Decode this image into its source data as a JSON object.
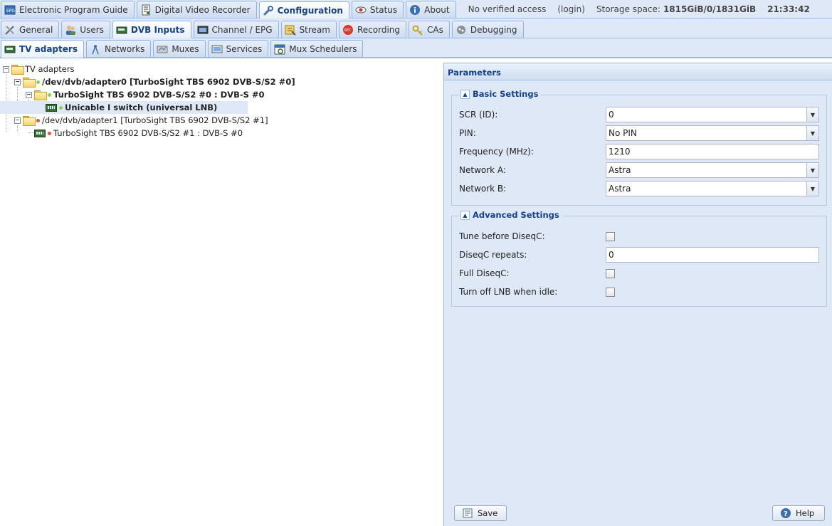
{
  "top_tabs": [
    {
      "label": "Electronic Program Guide",
      "icon": "epg-icon"
    },
    {
      "label": "Digital Video Recorder",
      "icon": "dvr-icon"
    },
    {
      "label": "Configuration",
      "icon": "wrench-icon",
      "active": true
    },
    {
      "label": "Status",
      "icon": "eye-icon"
    },
    {
      "label": "About",
      "icon": "info-icon"
    }
  ],
  "top_info": {
    "access": "No verified access",
    "login": "(login)",
    "storage_label": "Storage space:",
    "storage_value": "1815GiB/0/1831GiB",
    "time": "21:33:42"
  },
  "config_tabs": [
    {
      "label": "General"
    },
    {
      "label": "Users"
    },
    {
      "label": "DVB Inputs",
      "active": true
    },
    {
      "label": "Channel / EPG"
    },
    {
      "label": "Stream"
    },
    {
      "label": "Recording"
    },
    {
      "label": "CAs"
    },
    {
      "label": "Debugging"
    }
  ],
  "dvb_tabs": [
    {
      "label": "TV adapters",
      "active": true
    },
    {
      "label": "Networks"
    },
    {
      "label": "Muxes"
    },
    {
      "label": "Services"
    },
    {
      "label": "Mux Schedulers"
    }
  ],
  "tree": {
    "root": "TV adapters",
    "adapter0": "/dev/dvb/adapter0 [TurboSight TBS 6902 DVB-S/S2 #0]",
    "frontend0": "TurboSight TBS 6902 DVB-S/S2 #0 : DVB-S #0",
    "lnb0": "Unicable I switch (universal LNB)",
    "adapter1": "/dev/dvb/adapter1 [TurboSight TBS 6902 DVB-S/S2 #1]",
    "frontend1": "TurboSight TBS 6902 DVB-S/S2 #1 : DVB-S #0",
    "status_colors": {
      "enabled": "#8fd14f",
      "disabled": "#e05545"
    }
  },
  "params": {
    "title": "Parameters",
    "basic": {
      "legend": "Basic Settings",
      "scr_label": "SCR (ID):",
      "scr_value": "0",
      "pin_label": "PIN:",
      "pin_value": "No PIN",
      "freq_label": "Frequency (MHz):",
      "freq_value": "1210",
      "neta_label": "Network A:",
      "neta_value": "Astra",
      "netb_label": "Network B:",
      "netb_value": "Astra"
    },
    "advanced": {
      "legend": "Advanced Settings",
      "tune_label": "Tune before DiseqC:",
      "tune_checked": false,
      "repeats_label": "DiseqC repeats:",
      "repeats_value": "0",
      "full_label": "Full DiseqC:",
      "full_checked": false,
      "lnboff_label": "Turn off LNB when idle:",
      "lnboff_checked": false
    },
    "save_label": "Save",
    "help_label": "Help"
  }
}
